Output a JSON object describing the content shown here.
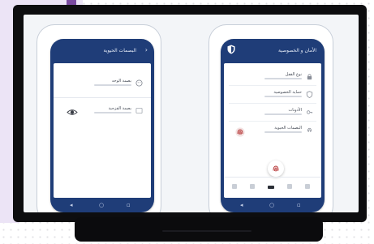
{
  "left_phone": {
    "header_title": "البصمات الحيوية",
    "items": [
      {
        "label": "بصمة الوجه",
        "icon": "face-icon"
      },
      {
        "label": "بصمة القزحية",
        "icon": "eye-icon"
      }
    ]
  },
  "right_phone": {
    "header_title": "الأمان و الخصوصية",
    "items": [
      {
        "label": "نوع القفل",
        "icon": "lock-icon"
      },
      {
        "label": "حماية الخصوصية",
        "icon": "shield-icon"
      },
      {
        "label": "الأذونات",
        "icon": "key-icon"
      },
      {
        "label": "البصمات الحيوية",
        "icon": "fingerprint-icon"
      }
    ]
  },
  "nav_icons": [
    "back-icon",
    "home-icon",
    "recents-icon"
  ],
  "colors": {
    "phone_frame": "#1f3d78",
    "monitor_bezel": "#0d0d0f",
    "lavender_panel": "#ece4f6",
    "accent_purple": "#7a4aa0",
    "fingerprint_red": "#b83a3a"
  }
}
